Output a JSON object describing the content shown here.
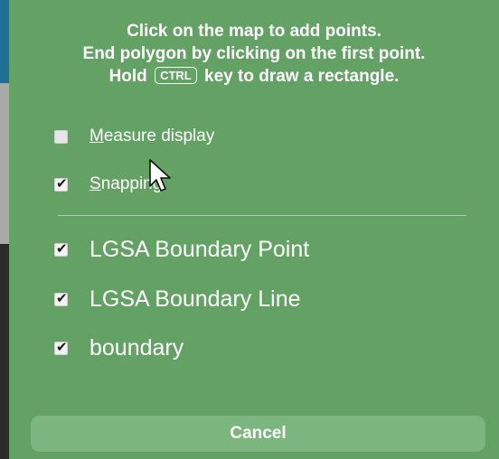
{
  "instructions": {
    "line1": "Click on the map to add points.",
    "line2": "End polygon by clicking on the first point.",
    "line3_prefix": "Hold",
    "line3_key": "CTRL",
    "line3_suffix": "key to draw a rectangle."
  },
  "options": {
    "measure_display": {
      "label": "Measure display",
      "checked": false
    },
    "snapping": {
      "label": "Snapping",
      "checked": true
    }
  },
  "layers": [
    {
      "label": "LGSA Boundary Point",
      "checked": true
    },
    {
      "label": "LGSA Boundary Line",
      "checked": true
    },
    {
      "label": "boundary",
      "checked": true
    }
  ],
  "cancel_label": "Cancel",
  "icons": {
    "check": "✔",
    "cursor": "mouse-pointer-icon"
  },
  "colors": {
    "panel_bg": "#64a165",
    "button_bg": "#7cb57d",
    "text": "#ffffff"
  }
}
